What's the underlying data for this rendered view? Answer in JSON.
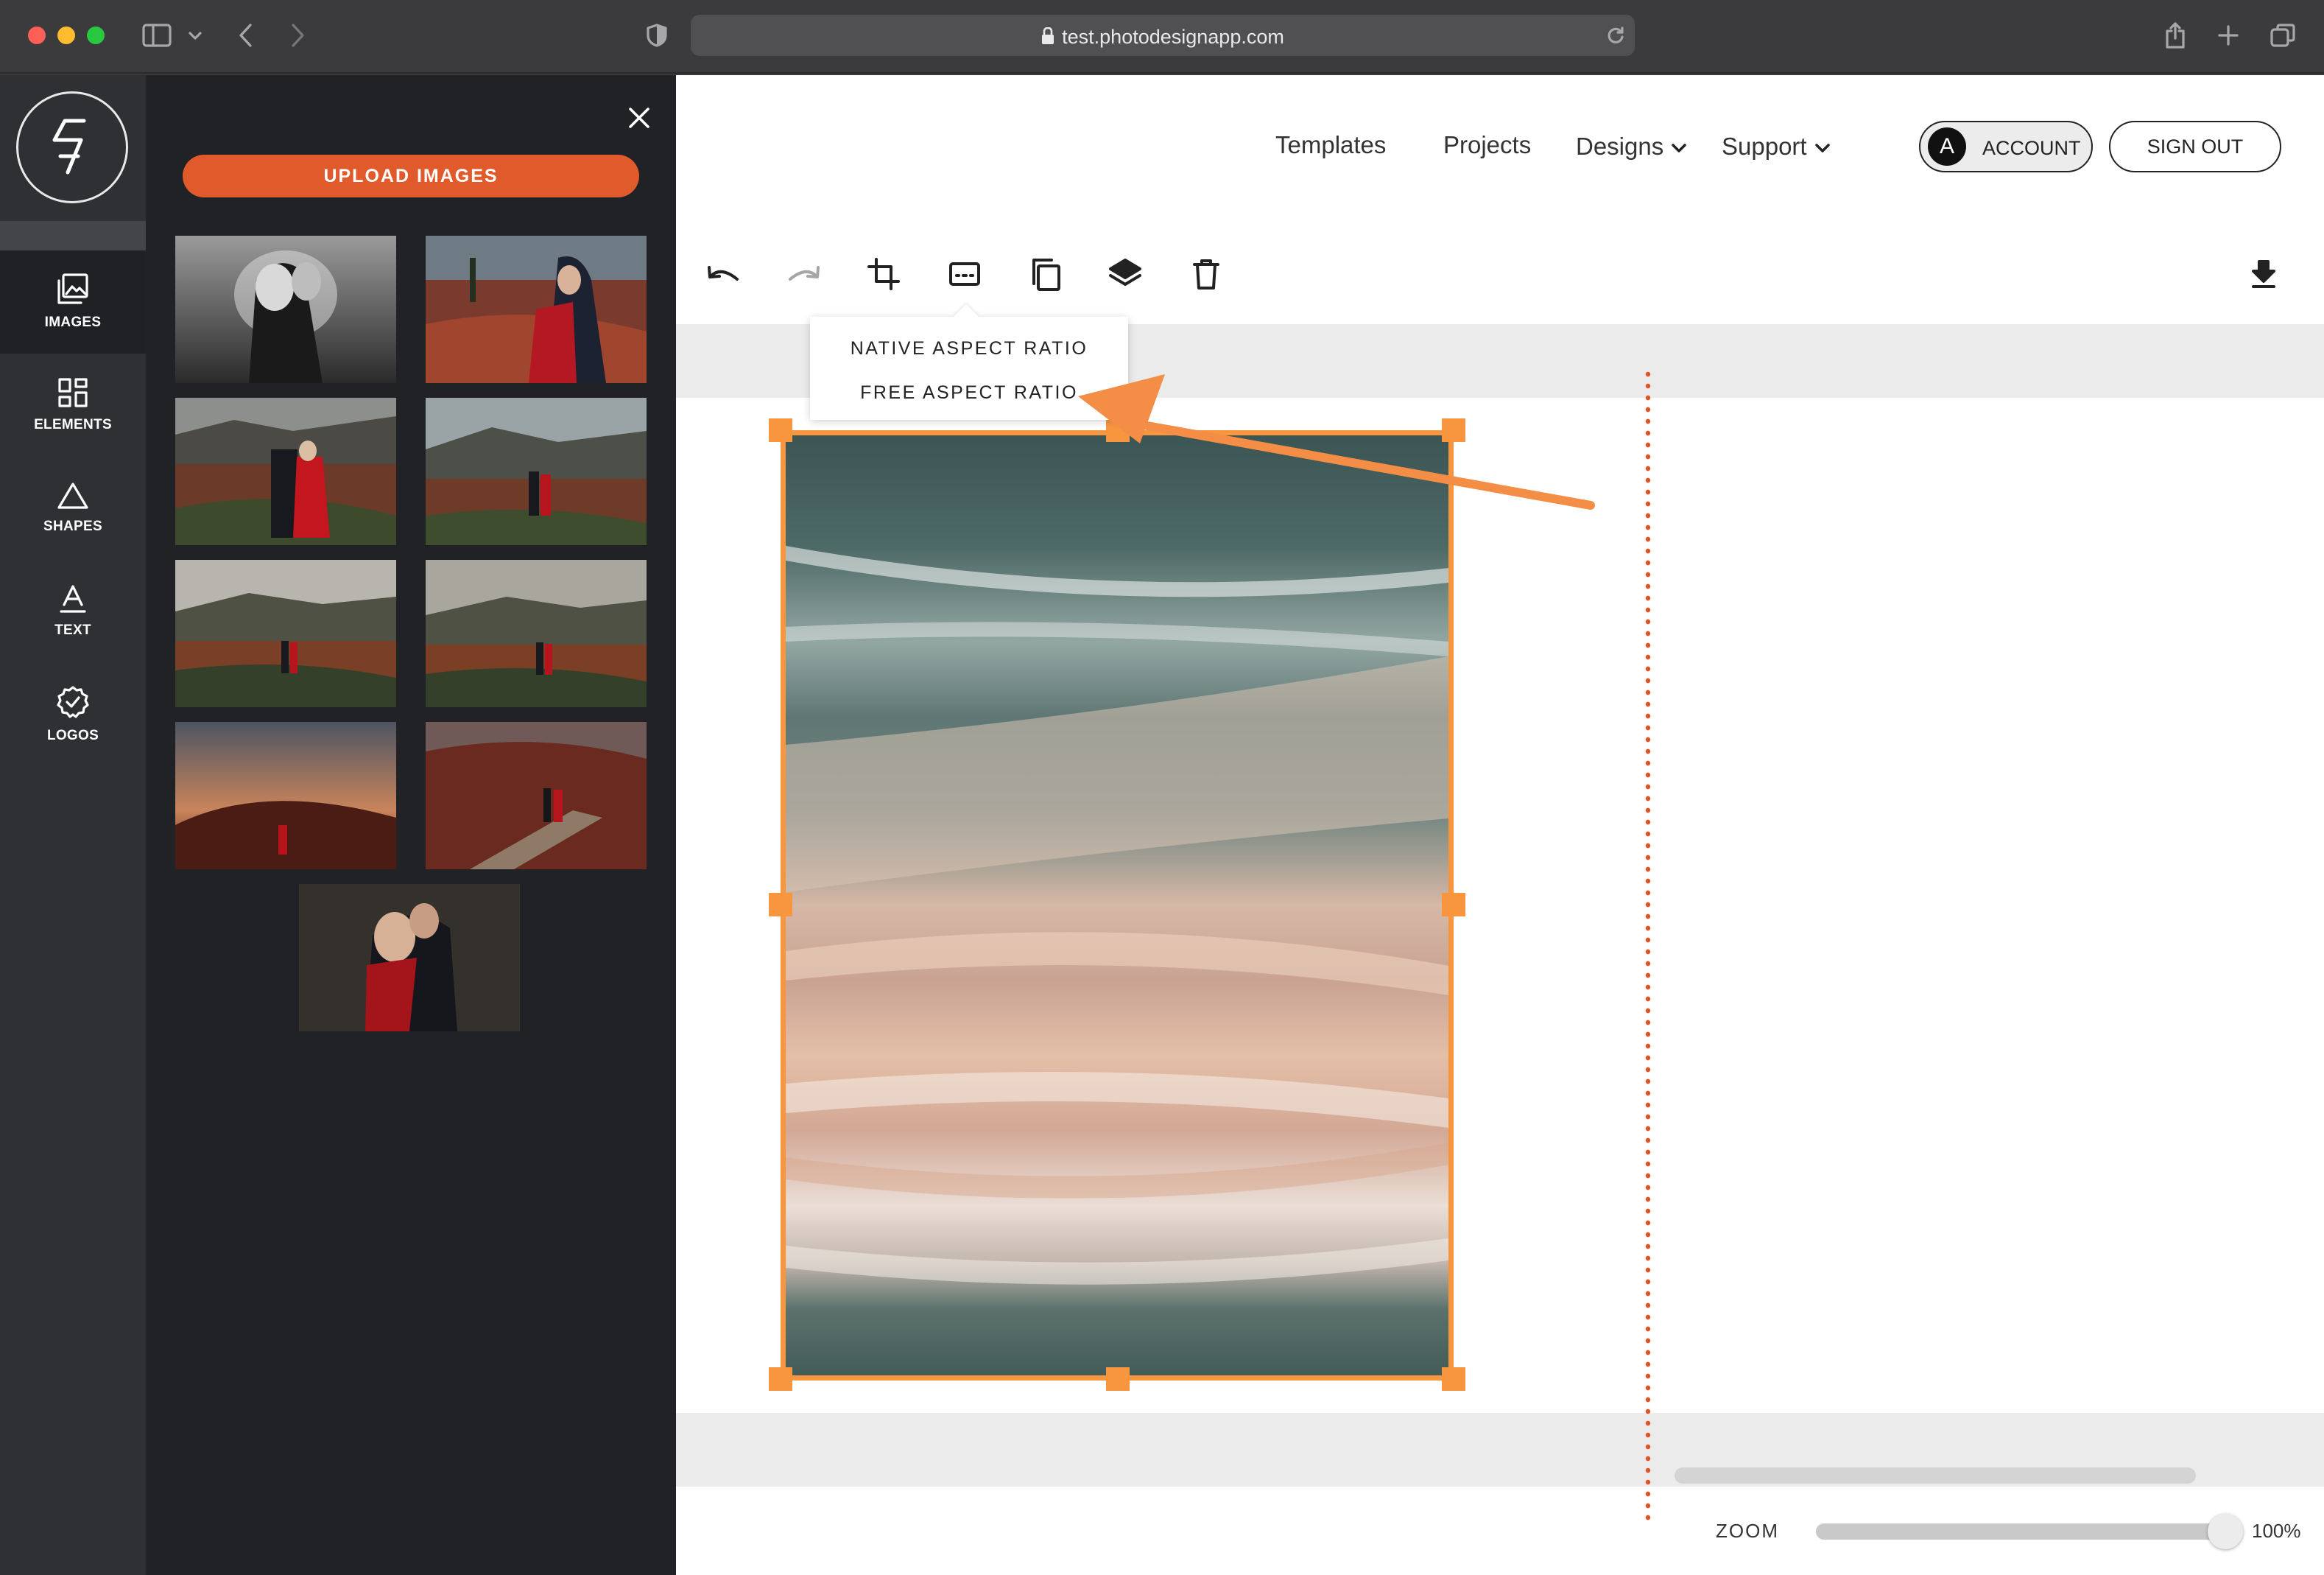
{
  "browser": {
    "url": "test.photodesignapp.com"
  },
  "colors": {
    "accent": "#e05a2b",
    "selection": "#f7963f",
    "rail_bg": "#2f3033",
    "panel_bg": "#202225"
  },
  "rail": {
    "items": [
      {
        "label": "IMAGES",
        "icon": "images-icon",
        "active": true
      },
      {
        "label": "ELEMENTS",
        "icon": "elements-icon",
        "active": false
      },
      {
        "label": "SHAPES",
        "icon": "triangle-icon",
        "active": false
      },
      {
        "label": "TEXT",
        "icon": "text-icon",
        "active": false
      },
      {
        "label": "LOGOS",
        "icon": "badge-check-icon",
        "active": false
      }
    ]
  },
  "panel": {
    "upload_label": "UPLOAD IMAGES",
    "thumbnails": 9
  },
  "header": {
    "nav": [
      {
        "label": "Templates"
      },
      {
        "label": "Projects"
      },
      {
        "label": "Designs",
        "has_dropdown": true
      },
      {
        "label": "Support",
        "has_dropdown": true
      }
    ],
    "account_initial": "A",
    "account_label": "ACCOUNT",
    "signout_label": "SIGN OUT"
  },
  "toolbar": {
    "tools": [
      "undo-icon",
      "redo-icon",
      "crop-icon",
      "aspect-ratio-icon",
      "duplicate-icon",
      "layers-icon",
      "trash-icon"
    ],
    "download": "download-icon"
  },
  "aspect_menu": {
    "items": [
      "NATIVE ASPECT RATIO",
      "FREE ASPECT RATIO"
    ]
  },
  "zoom": {
    "label": "ZOOM",
    "value_text": "100%",
    "level": 1.0
  }
}
